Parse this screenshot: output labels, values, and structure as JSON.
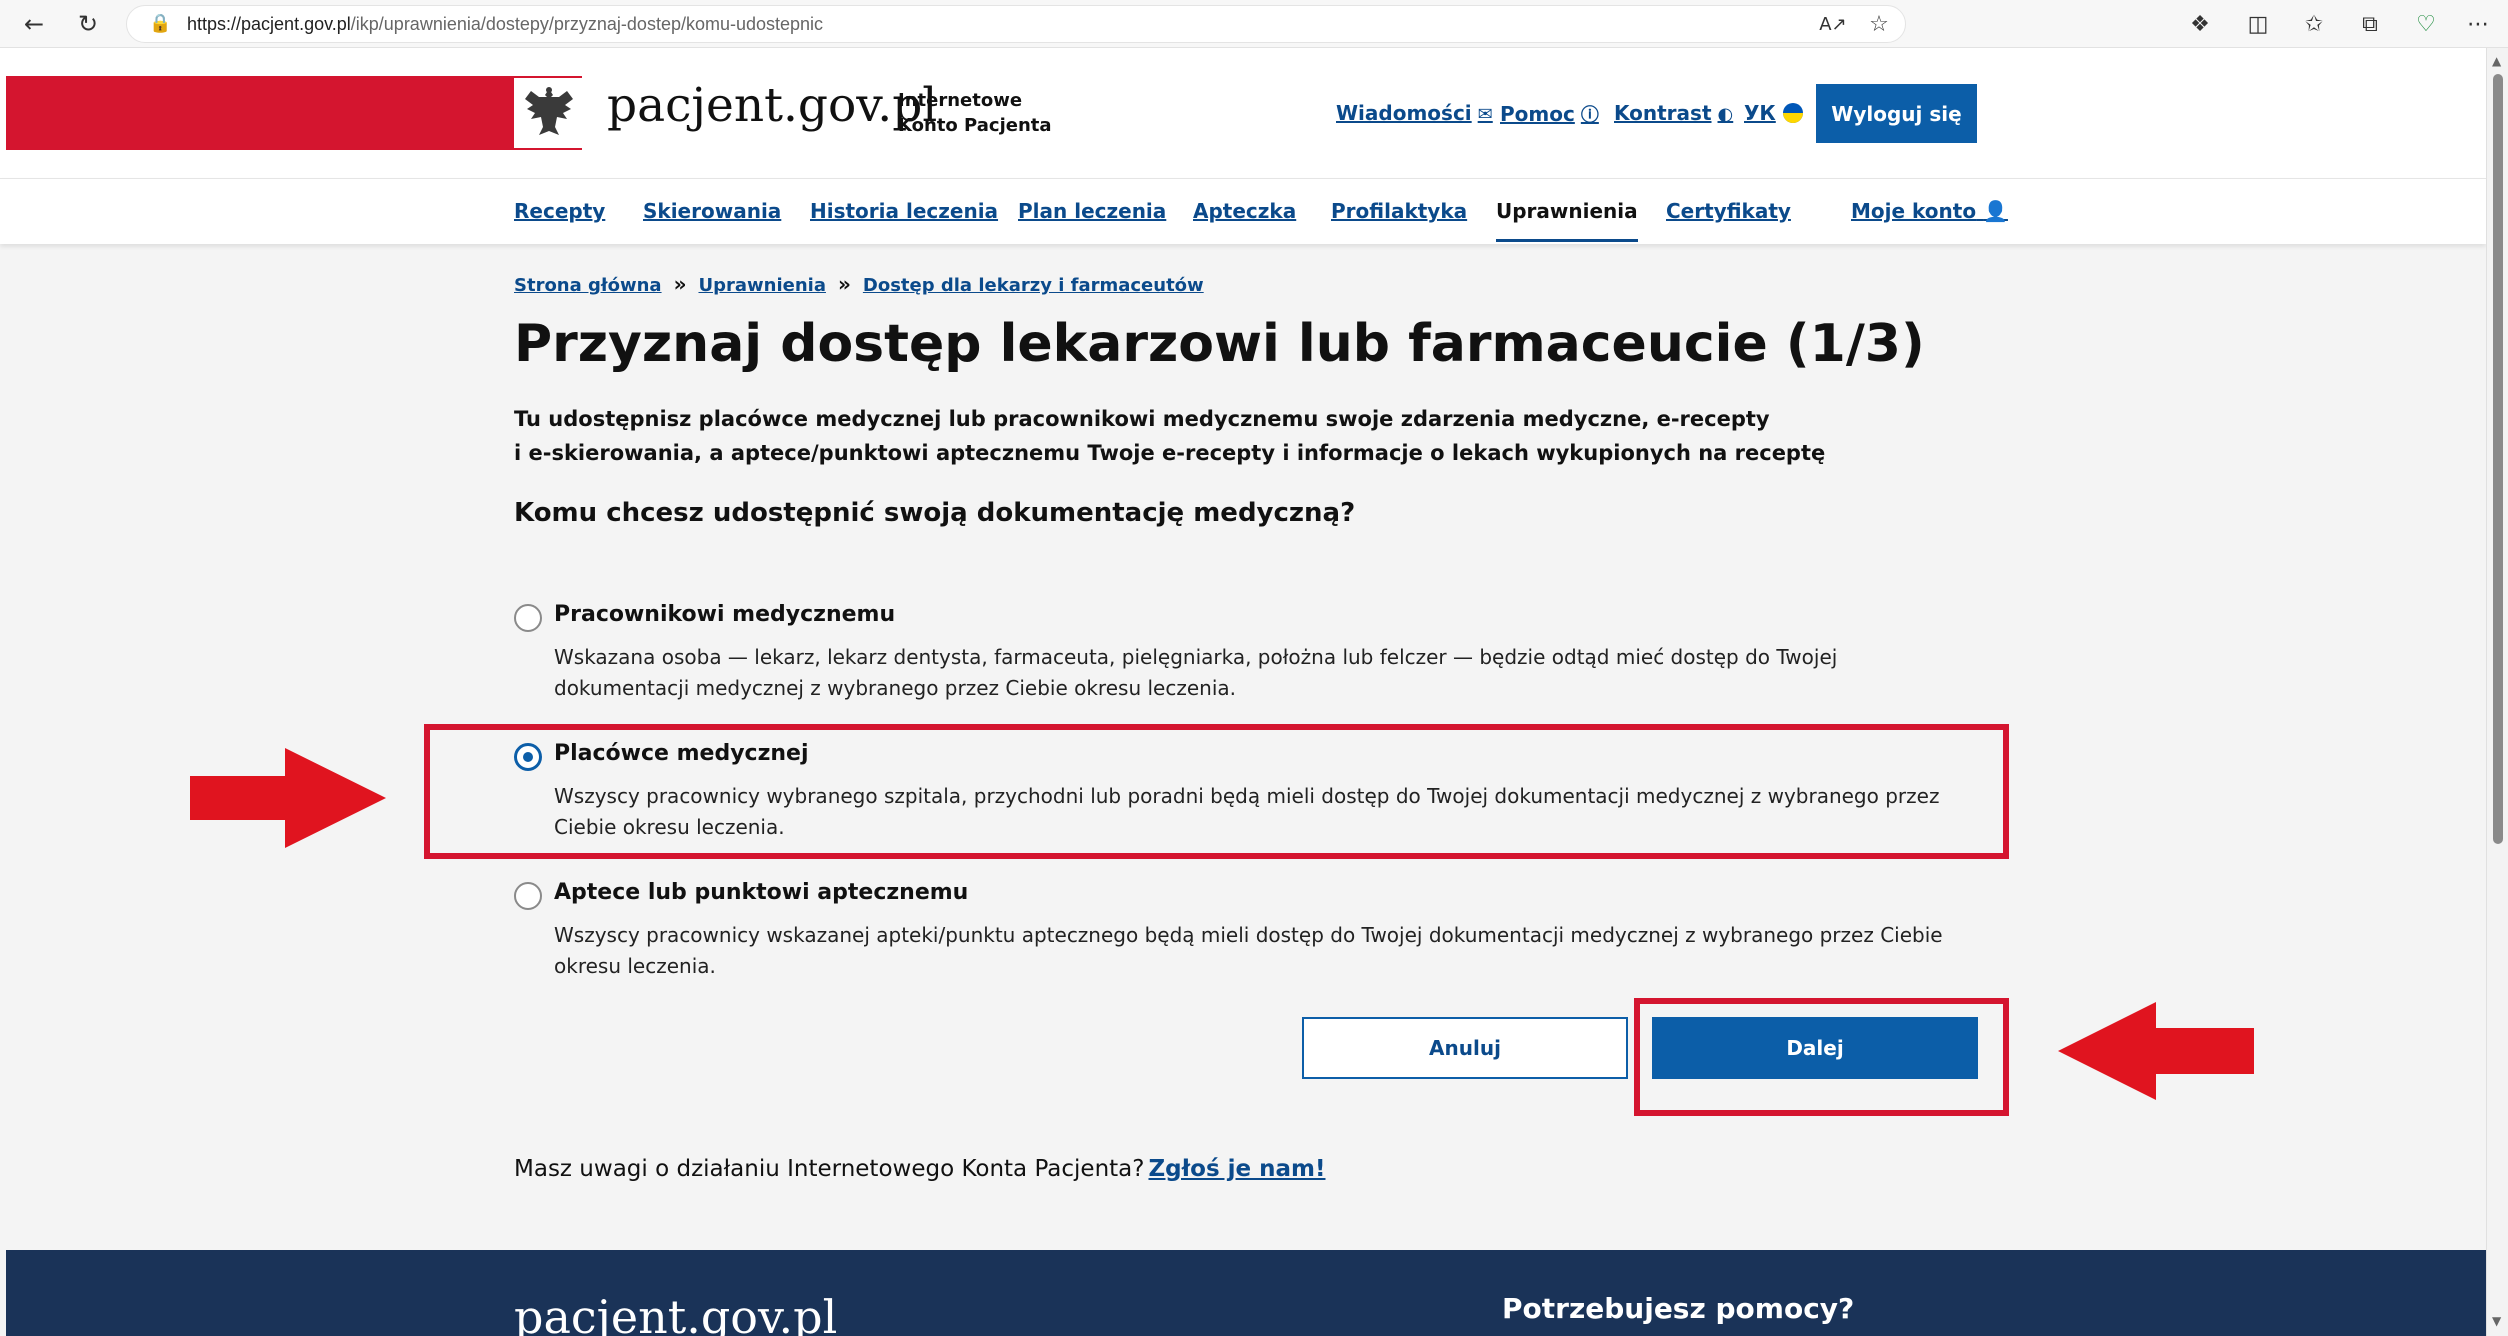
{
  "browser": {
    "url_host": "https://pacjent.gov.pl",
    "url_path": "/ikp/uprawnienia/dostepy/przyznaj-dostep/komu-udostepnic",
    "icons": [
      "back-icon",
      "refresh-icon",
      "lock-icon",
      "read-aloud-icon",
      "favorite-star-icon",
      "extensions-icon",
      "split-screen-icon",
      "favorites-icon",
      "collections-icon",
      "health-icon",
      "more-icon"
    ]
  },
  "header": {
    "logo": "pacjent.gov.pl",
    "subtitle_line1": "Internetowe",
    "subtitle_line2": "Konto Pacjenta",
    "links": {
      "messages": "Wiadomości",
      "help": "Pomoc",
      "contrast": "Kontrast",
      "language": "УК"
    },
    "logout": "Wyloguj się"
  },
  "nav": {
    "items": [
      "Recepty",
      "Skierowania",
      "Historia leczenia",
      "Plan leczenia",
      "Apteczka",
      "Profilaktyka",
      "Uprawnienia",
      "Certyfikaty"
    ],
    "account": "Moje konto",
    "active": "Uprawnienia"
  },
  "breadcrumb": [
    "Strona główna",
    "Uprawnienia",
    "Dostęp dla lekarzy i farmaceutów"
  ],
  "title": "Przyznaj dostęp lekarzowi lub farmaceucie (1/3)",
  "intro_line1": "Tu udostępnisz placówce medycznej lub pracownikowi medycznemu swoje zdarzenia medyczne, e-recepty",
  "intro_line2": "i e-skierowania, a aptece/punktowi aptecznemu Twoje e-recepty i informacje o lekach wykupionych na receptę",
  "question": "Komu chcesz udostępnić swoją dokumentację medyczną?",
  "options": [
    {
      "title": "Pracownikowi medycznemu",
      "desc": "Wskazana osoba — lekarz, lekarz dentysta, farmaceuta, pielęgniarka, położna lub felczer — będzie odtąd mieć dostęp do Twojej dokumentacji medycznej z wybranego przez Ciebie okresu leczenia.",
      "selected": false
    },
    {
      "title": "Placówce medycznej",
      "desc": "Wszyscy pracownicy wybranego szpitala, przychodni lub poradni będą mieli dostęp do Twojej dokumentacji medycznej z wybranego przez Ciebie okresu leczenia.",
      "selected": true
    },
    {
      "title": "Aptece lub punktowi aptecznemu",
      "desc": "Wszyscy pracownicy wskazanej apteki/punktu aptecznego będą mieli dostęp do Twojej dokumentacji medycznej z wybranego przez Ciebie okresu leczenia.",
      "selected": false
    }
  ],
  "buttons": {
    "cancel": "Anuluj",
    "next": "Dalej"
  },
  "feedback": {
    "text": "Masz uwagi o działaniu Internetowego Konta Pacjenta?",
    "link": "Zgłoś je nam!"
  },
  "footer": {
    "logo": "pacjent.gov.pl",
    "help": "Potrzebujesz pomocy?"
  },
  "colors": {
    "brand_red": "#d4152f",
    "brand_blue": "#0c5ea8",
    "link_blue": "#0b4a8b",
    "footer_navy": "#1a3358",
    "annotation_red": "#e0141f"
  }
}
